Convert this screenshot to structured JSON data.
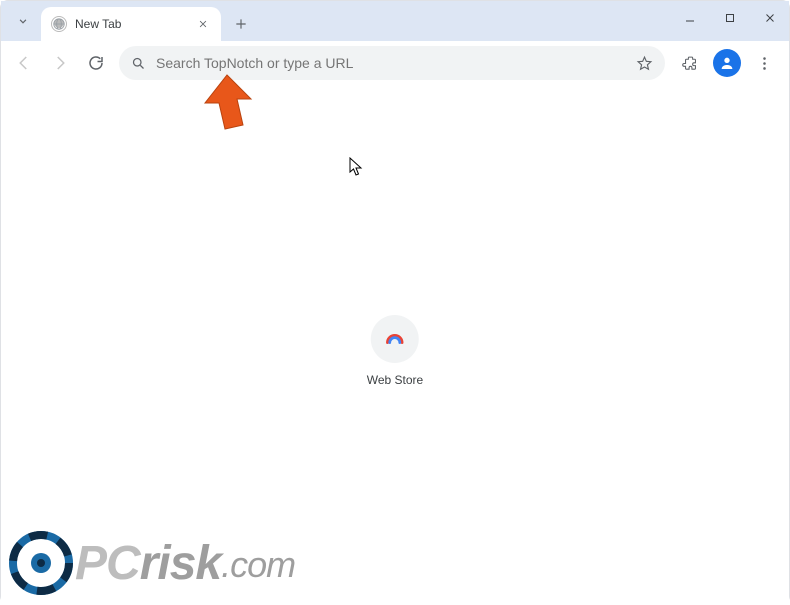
{
  "window": {
    "tab_title": "New Tab",
    "controls": {
      "minimize": "minimize",
      "maximize": "maximize",
      "close": "close"
    }
  },
  "toolbar": {
    "back": "back",
    "forward": "forward",
    "reload": "reload",
    "omnibox_placeholder": "Search TopNotch or type a URL",
    "bookmark": "bookmark",
    "extensions": "extensions",
    "profile": "profile",
    "menu": "menu"
  },
  "content": {
    "shortcut_label": "Web Store"
  },
  "watermark": {
    "text_pc": "PC",
    "text_risk": "risk",
    "text_domain": ".com"
  },
  "annotation": {
    "arrow_color": "#e8571a"
  }
}
